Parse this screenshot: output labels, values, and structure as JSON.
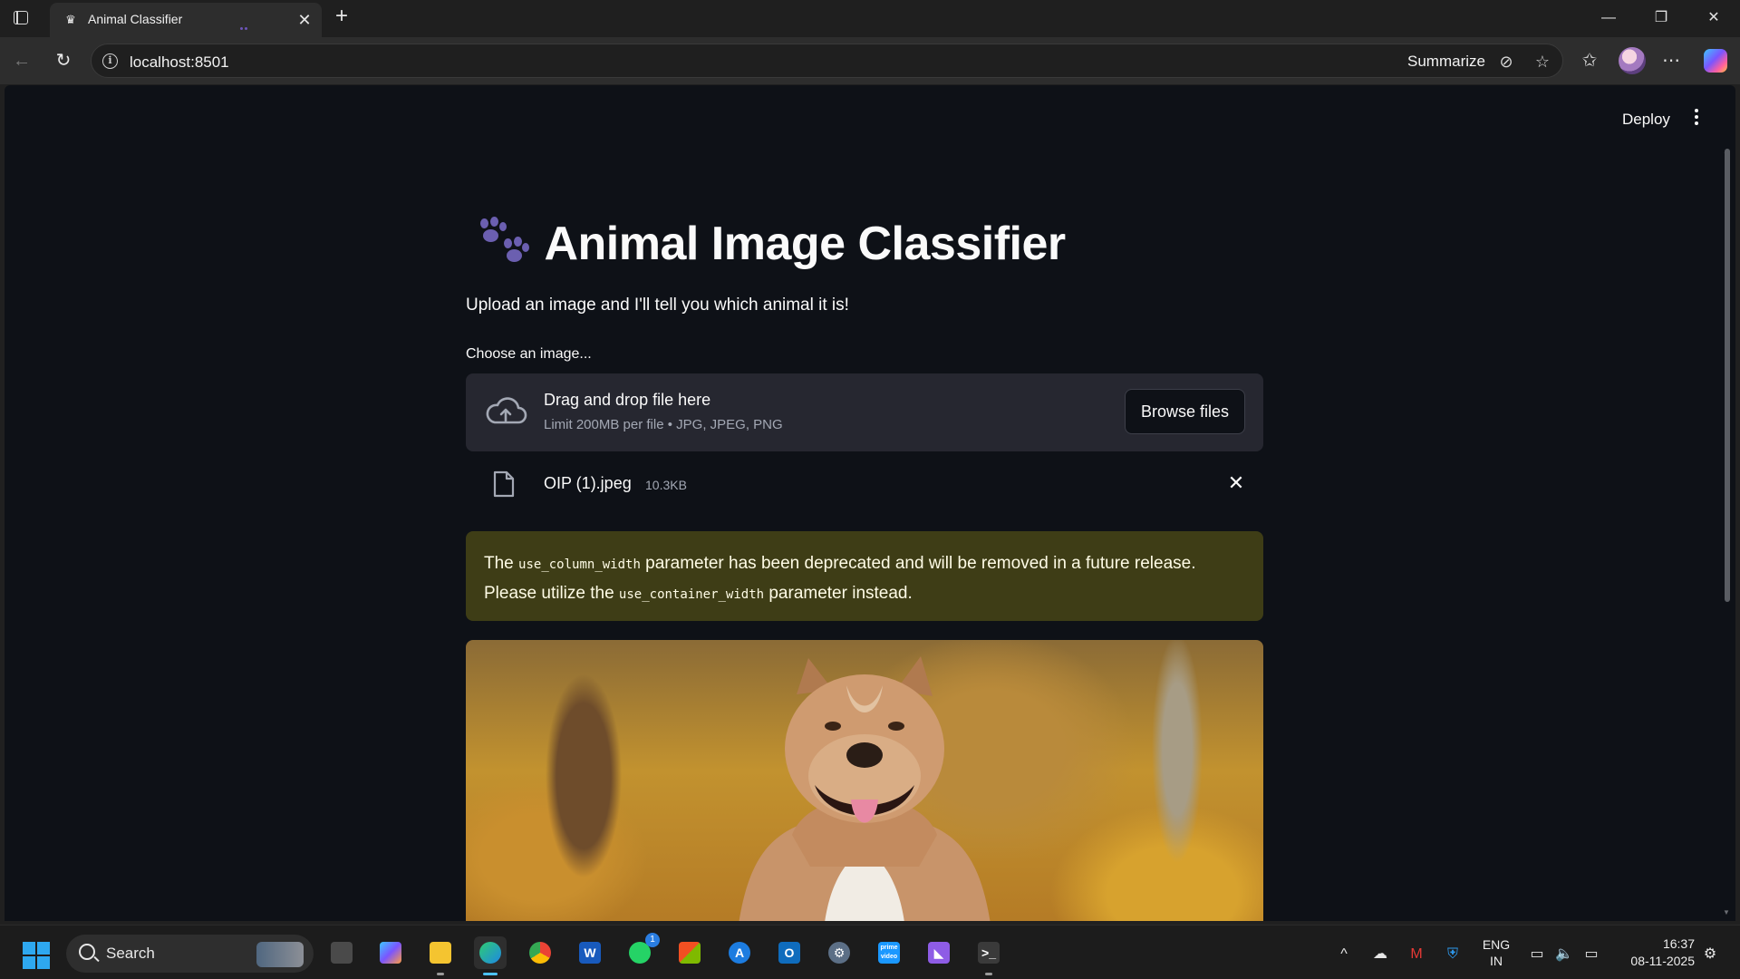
{
  "browser": {
    "tab_title": "Animal Classifier",
    "url": "localhost:8501",
    "summarize_label": "Summarize"
  },
  "app": {
    "deploy_label": "Deploy",
    "title": "Animal Image Classifier",
    "subtitle": "Upload an image and I'll tell you which animal it is!",
    "uploader": {
      "label": "Choose an image...",
      "dropzone_title": "Drag and drop file here",
      "dropzone_limit": "Limit 200MB per file • JPG, JPEG, PNG",
      "browse_label": "Browse files"
    },
    "uploaded_file": {
      "name": "OIP (1).jpeg",
      "size": "10.3KB"
    },
    "warning": {
      "text_1": "The ",
      "code_1": "use_column_width",
      "text_2": " parameter has been deprecated and will be removed in a future release. Please utilize the ",
      "code_2": "use_container_width",
      "text_3": " parameter instead."
    },
    "colors": {
      "background": "#0e1117",
      "dropzone": "#262730",
      "warning_bg": "#3e3d16",
      "warning_text": "#fffce6",
      "paw_icon": "#6b5fb0"
    }
  },
  "taskbar": {
    "search_placeholder": "Search",
    "whatsapp_badge": "1",
    "language": "ENG",
    "region": "IN",
    "time": "16:37",
    "date": "08-11-2025",
    "apps": [
      "task-view",
      "copilot",
      "file-explorer",
      "edge",
      "chrome",
      "word",
      "whatsapp",
      "microsoft-store",
      "app-store",
      "outlook",
      "settings",
      "prime-video",
      "visual-studio",
      "terminal"
    ]
  }
}
